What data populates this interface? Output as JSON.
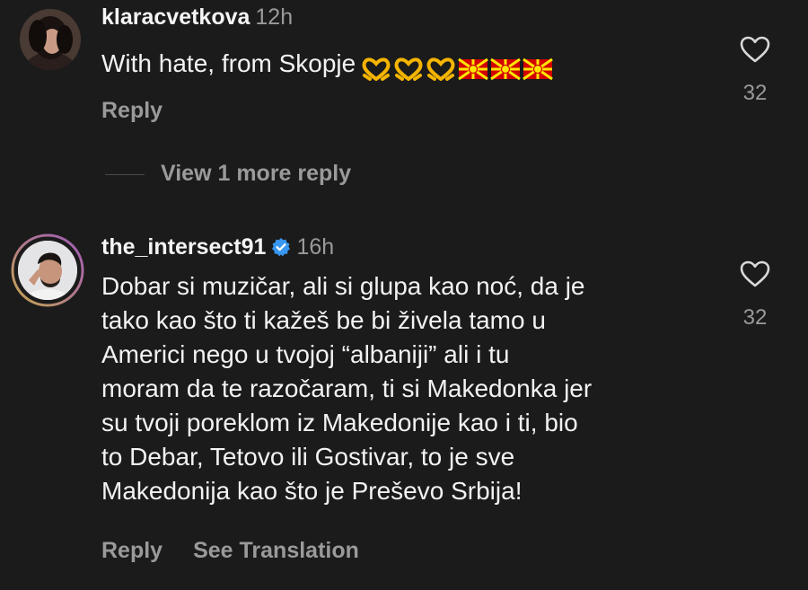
{
  "comments": [
    {
      "username": "klaracvetkova",
      "time": "12h",
      "text": "With hate, from Skopje",
      "emojis": [
        "heart-hands",
        "heart-hands",
        "heart-hands",
        "macedonia-flag",
        "macedonia-flag",
        "macedonia-flag"
      ],
      "reply_label": "Reply",
      "like_count": "32"
    },
    {
      "username": "the_intersect91",
      "verified": true,
      "time": "16h",
      "text": "Dobar si muzičar, ali si glupa kao noć, da je\ntako kao što ti kažeš be bi živela tamo u\nAmerici nego u tvojoj “albaniji” ali i tu\nmoram da te razočaram, ti si Makedonka jer\nsu tvoji poreklom iz Makedonije kao i ti, bio\nto Debar, Tetovo ili Gostivar, to je sve\nMakedonija kao što je Preševo Srbija!",
      "reply_label": "Reply",
      "translation_label": "See Translation",
      "like_count": "32"
    }
  ],
  "view_more_replies": "View 1 more reply",
  "colors": {
    "background": "#1b1b1b",
    "text": "#f5f5f5",
    "muted": "#9a9a9a",
    "verified": "#3897f0",
    "heart_emoji": "#f4b400",
    "flag_red": "#d20000",
    "flag_yellow": "#ffe600"
  },
  "icons": {
    "like": "heart-outline-icon",
    "verified": "verified-badge-icon"
  }
}
